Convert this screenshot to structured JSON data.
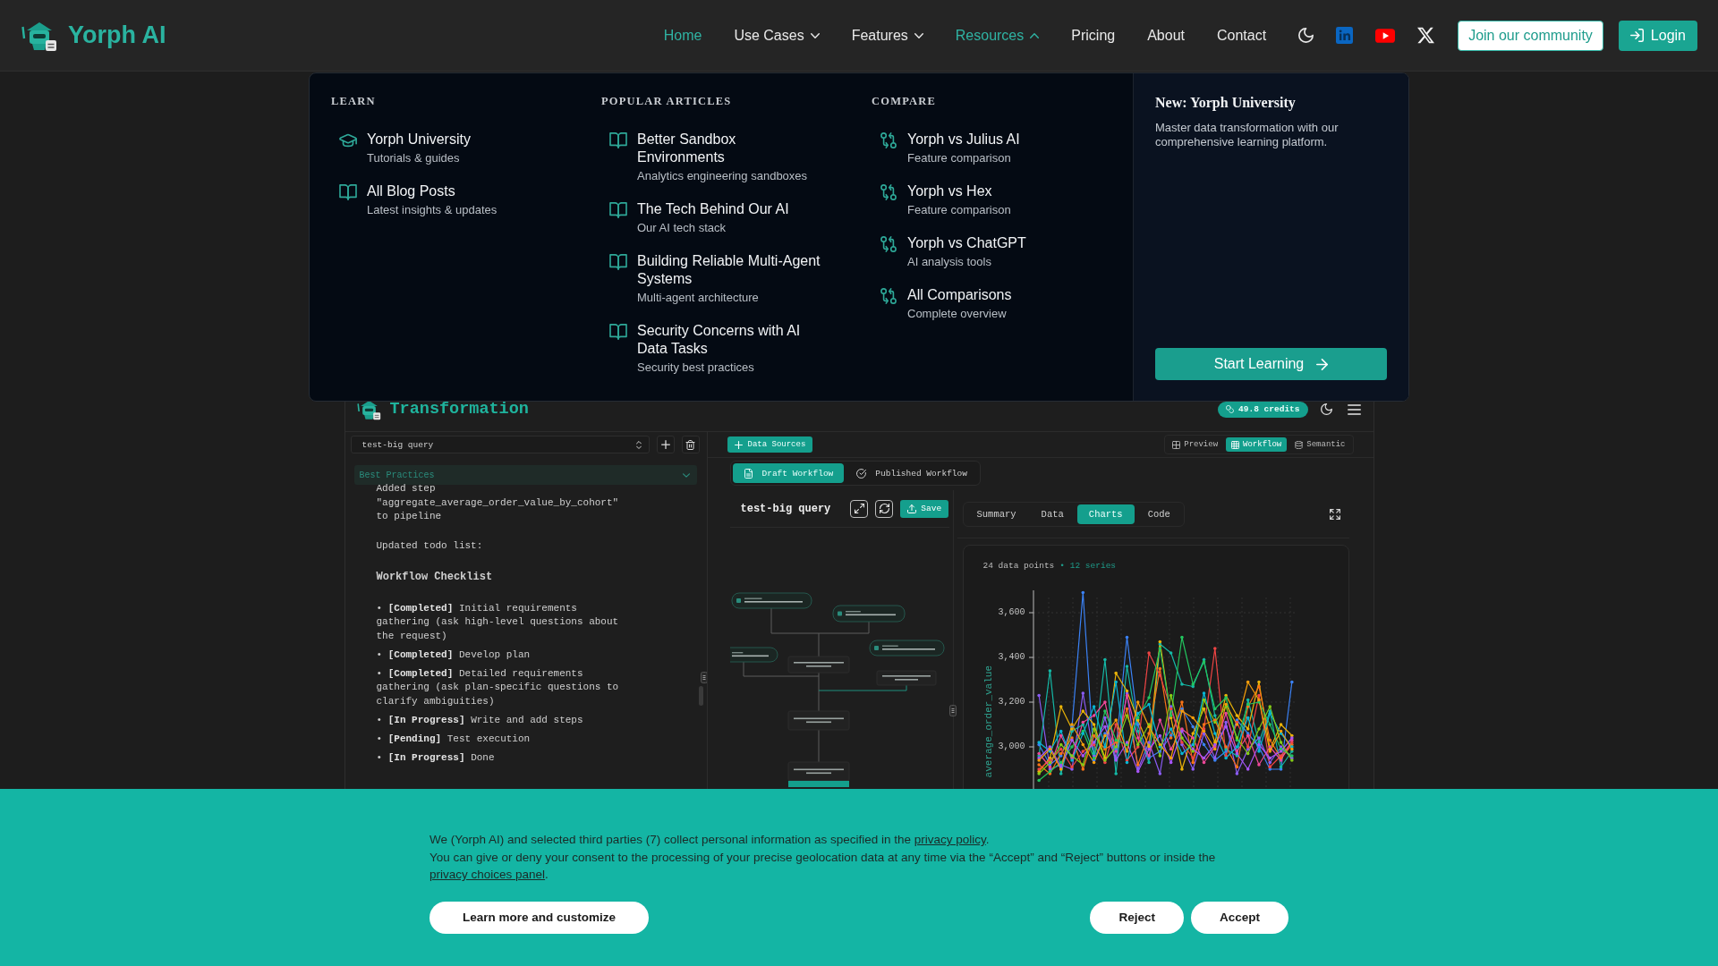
{
  "header": {
    "logo_text": "Yorph AI",
    "nav": [
      {
        "label": "Home",
        "kind": "link",
        "selected": true
      },
      {
        "label": "Use Cases",
        "kind": "menu",
        "selected": false,
        "expanded": false
      },
      {
        "label": "Features",
        "kind": "menu",
        "selected": false,
        "expanded": false
      },
      {
        "label": "Resources",
        "kind": "menu",
        "selected": true,
        "expanded": true
      },
      {
        "label": "Pricing",
        "kind": "link",
        "selected": false
      },
      {
        "label": "About",
        "kind": "link",
        "selected": false
      },
      {
        "label": "Contact",
        "kind": "link",
        "selected": false
      }
    ],
    "community_button": "Join our community",
    "login_button": "Login"
  },
  "resources_menu": {
    "columns": [
      {
        "heading": "LEARN",
        "items": [
          {
            "kind": "course",
            "title": "Yorph University",
            "subtitle": "Tutorials & guides"
          },
          {
            "kind": "article",
            "title": "All Blog Posts",
            "subtitle": "Latest insights & updates"
          }
        ]
      },
      {
        "heading": "POPULAR ARTICLES",
        "items": [
          {
            "kind": "article",
            "title": "Better Sandbox Environments",
            "subtitle": "Analytics engineering sandboxes"
          },
          {
            "kind": "article",
            "title": "The Tech Behind Our AI",
            "subtitle": "Our AI tech stack"
          },
          {
            "kind": "article",
            "title": "Building Reliable Multi-Agent Systems",
            "subtitle": "Multi-agent architecture"
          },
          {
            "kind": "article",
            "title": "Security Concerns with AI Data Tasks",
            "subtitle": "Security best practices"
          }
        ]
      },
      {
        "heading": "COMPARE",
        "items": [
          {
            "kind": "comparison",
            "title": "Yorph vs Julius AI",
            "subtitle": "Feature comparison"
          },
          {
            "kind": "comparison",
            "title": "Yorph vs Hex",
            "subtitle": "Feature comparison"
          },
          {
            "kind": "comparison",
            "title": "Yorph vs ChatGPT",
            "subtitle": "AI analysis tools"
          },
          {
            "kind": "comparison",
            "title": "All Comparisons",
            "subtitle": "Complete overview"
          }
        ]
      }
    ],
    "feature": {
      "title": "New: Yorph University",
      "text": "Master data transformation with our comprehensive learning platform.",
      "button": "Start Learning"
    }
  },
  "app": {
    "title": "Transformation",
    "credits": "49.8 credits",
    "workflow_select": "test-big query",
    "best_practices": "Best Practices",
    "chat": [
      {
        "kind": "text",
        "text": "Added step \"aggregate_average_order_value_by_cohort\" to pipeline"
      },
      {
        "kind": "text",
        "text": "Updated todo list:"
      },
      {
        "kind": "heading",
        "text": "Workflow Checklist"
      },
      {
        "kind": "item",
        "text": "• **[Completed]** Initial requirements gathering (ask high-level questions about the request)"
      },
      {
        "kind": "item",
        "text": "• **[Completed]** Develop plan"
      },
      {
        "kind": "item",
        "text": "• **[Completed]** Detailed requirements gathering (ask plan-specific questions to clarify ambiguities)"
      },
      {
        "kind": "item",
        "text": "• **[In Progress]** Write and add steps"
      },
      {
        "kind": "item",
        "text": "• **[Pending]** Test execution"
      },
      {
        "kind": "item",
        "text": "• **[In Progress]** Done"
      }
    ],
    "data_sources_button": "Data Sources",
    "view_modes": [
      {
        "label": "Preview",
        "kind": "grid",
        "selected": false
      },
      {
        "label": "Workflow",
        "kind": "table",
        "selected": true
      },
      {
        "label": "Semantic",
        "kind": "database",
        "selected": false
      }
    ],
    "workflow_tabs": [
      {
        "label": "Draft Workflow",
        "kind": "draft",
        "selected": true
      },
      {
        "label": "Published Workflow",
        "kind": "published",
        "selected": false
      }
    ],
    "workflow_name": "test-big query",
    "save_button": "Save",
    "result_tabs": [
      {
        "label": "Summary",
        "selected": false
      },
      {
        "label": "Data",
        "selected": false
      },
      {
        "label": "Charts",
        "selected": true
      },
      {
        "label": "Code",
        "selected": false
      }
    ],
    "chart": {
      "points_text": "24 data points",
      "series_text": "• 12 series",
      "chart_data": {
        "type": "line",
        "ylabel": "average_order_value",
        "ylim": [
          2800,
          3700
        ],
        "grid": true,
        "yticks": [
          {
            "value": 3000,
            "label": "3,000"
          },
          {
            "value": 3200,
            "label": "3,200"
          },
          {
            "value": 3400,
            "label": "3,400"
          },
          {
            "value": 3600,
            "label": "3,600"
          }
        ],
        "series": [
          {
            "color": "#3b82f6",
            "values": [
              3010,
              2920,
              2960,
              3090,
              3690,
              2940,
              3060,
              2990,
              3490,
              3100,
              2950,
              2980,
              3050,
              3170,
              3090,
              3010,
              2940,
              2980,
              3120,
              3060,
              3000,
              2900,
              2900,
              3290
            ]
          },
          {
            "color": "#8b5cf6",
            "values": [
              3230,
              2900,
              2920,
              2900,
              3240,
              2960,
              3130,
              2950,
              3240,
              2900,
              3020,
              2880,
              3180,
              3010,
              2900,
              3060,
              2950,
              3110,
              2880,
              2990,
              3040,
              2930,
              3000,
              2950
            ]
          },
          {
            "color": "#14b8a6",
            "values": [
              2960,
              3340,
              2880,
              3070,
              3100,
              2970,
              3390,
              2880,
              3360,
              3070,
              2930,
              3460,
              3420,
              3280,
              3270,
              3390,
              3140,
              2990,
              2960,
              3210,
              3020,
              3160,
              2910,
              2980
            ]
          },
          {
            "color": "#eab308",
            "values": [
              2890,
              2950,
              3180,
              3080,
              3160,
              3100,
              2950,
              3330,
              3250,
              3120,
              3000,
              3470,
              3130,
              2900,
              3060,
              3170,
              3020,
              3230,
              3140,
              3080,
              3290,
              2990,
              3100,
              3050
            ]
          },
          {
            "color": "#f97316",
            "values": [
              2920,
              2880,
              2970,
              3040,
              2900,
              3050,
              2990,
              3020,
              3170,
              2920,
              3060,
              3350,
              3040,
              3200,
              2930,
              3100,
              3120,
              3000,
              2910,
              3180,
              3270,
              3030,
              2950,
              3010
            ]
          },
          {
            "color": "#ef4444",
            "values": [
              2900,
              2940,
              2990,
              2910,
              2980,
              3010,
              2930,
              3100,
              2940,
              3000,
              3420,
              3320,
              3170,
              3020,
              2950,
              3080,
              3440,
              2960,
              3110,
              3000,
              3230,
              2910,
              2960,
              3020
            ]
          },
          {
            "color": "#ec4899",
            "values": [
              2970,
              2910,
              3050,
              2950,
              3110,
              3140,
              3200,
              2980,
              3230,
              3040,
              2960,
              3120,
              2990,
              3080,
              3040,
              2930,
              3000,
              3150,
              2980,
              3050,
              2920,
              3000,
              2940,
              3030
            ]
          },
          {
            "color": "#22c55e",
            "values": [
              2850,
              2890,
              2930,
              3000,
              3070,
              2950,
              3160,
              3030,
              3010,
              3130,
              3220,
              3440,
              3140,
              3490,
              3280,
              3380,
              3170,
              3220,
              3030,
              3190,
              3200,
              3100,
              2990,
              2960
            ]
          },
          {
            "color": "#06b6d4",
            "values": [
              3020,
              2980,
              3070,
              2940,
              3060,
              3180,
              3000,
              3290,
              2930,
              3150,
              3190,
              3000,
              3080,
              2970,
              3010,
              3240,
              3060,
              2950,
              3000,
              3130,
              2980,
              3150,
              3060,
              3000
            ]
          },
          {
            "color": "#a855f7",
            "values": [
              2950,
              3000,
              2910,
              3030,
              2960,
              3020,
              3090,
              2940,
              3020,
              2890,
              2990,
              3050,
              2930,
              3070,
              2990,
              2950,
              3010,
              3090,
              2970,
              2900,
              3010,
              2950,
              2980,
              3040
            ]
          },
          {
            "color": "#84cc16",
            "values": [
              2880,
              2930,
              3010,
              2960,
              2920,
              3080,
              2940,
              3000,
              3140,
              3010,
              3100,
              2960,
              3230,
              3040,
              2980,
              3210,
              3110,
              3180,
              3040,
              2970,
              3080,
              3180,
              3020,
              2940
            ]
          },
          {
            "color": "#f59e0b",
            "values": [
              2940,
              2990,
              2900,
              3100,
              3010,
              2930,
              3050,
              3120,
              2980,
              3200,
              3090,
              3010,
              2950,
              3160,
              3130,
              3070,
              2990,
              3190,
              3100,
              3290,
              3210,
              2980,
              3070,
              2990
            ]
          }
        ]
      }
    }
  },
  "cookie_banner": {
    "paragraphs": [
      {
        "text": "We (Yorph AI) and selected third parties (7) collect personal information as specified in the ",
        "link": "privacy policy",
        "end": "."
      },
      {
        "text": "You can give or deny your consent to the processing of your precise geolocation data at any time via the “Accept” and “Reject” buttons or inside the ",
        "link": "privacy choices panel",
        "end": "."
      }
    ],
    "customize_button": "Learn more and customize",
    "buttons": [
      "Reject",
      "Accept"
    ]
  }
}
